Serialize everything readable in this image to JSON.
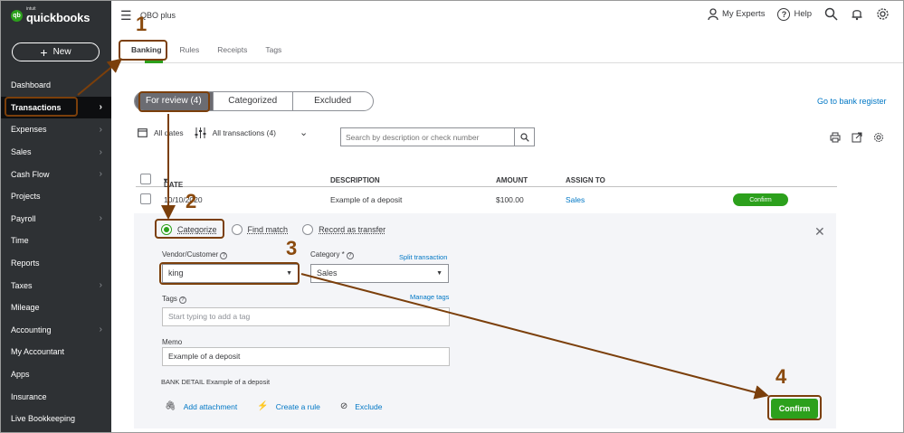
{
  "brand": {
    "logo_small": "intuit",
    "logo_name": "quickbooks",
    "logo_mark": "qb"
  },
  "sidebar": {
    "new_label": "New",
    "items": [
      {
        "label": "Dashboard",
        "chevron": false
      },
      {
        "label": "Transactions",
        "chevron": true,
        "active": true
      },
      {
        "label": "Expenses",
        "chevron": true
      },
      {
        "label": "Sales",
        "chevron": true
      },
      {
        "label": "Cash Flow",
        "chevron": true
      },
      {
        "label": "Projects",
        "chevron": false
      },
      {
        "label": "Payroll",
        "chevron": true
      },
      {
        "label": "Time",
        "chevron": false
      },
      {
        "label": "Reports",
        "chevron": false
      },
      {
        "label": "Taxes",
        "chevron": true
      },
      {
        "label": "Mileage",
        "chevron": false
      },
      {
        "label": "Accounting",
        "chevron": true
      },
      {
        "label": "My Accountant",
        "chevron": false
      },
      {
        "label": "Apps",
        "chevron": false
      },
      {
        "label": "Insurance",
        "chevron": false
      },
      {
        "label": "Live Bookkeeping",
        "chevron": false
      }
    ]
  },
  "header": {
    "company": "QBO plus",
    "my_experts": "My Experts",
    "help": "Help"
  },
  "tabs": [
    {
      "label": "Banking",
      "active": true
    },
    {
      "label": "Rules"
    },
    {
      "label": "Receipts"
    },
    {
      "label": "Tags"
    }
  ],
  "review_tabs": {
    "for_review": "For review (4)",
    "categorized": "Categorized",
    "excluded": "Excluded"
  },
  "go_to_register": "Go to bank register",
  "filters": {
    "dates": "All dates",
    "transactions": "All transactions (4)",
    "search_placeholder": "Search by description or check number"
  },
  "table": {
    "headers": {
      "date": "DATE",
      "description": "DESCRIPTION",
      "amount": "AMOUNT",
      "assign_to": "ASSIGN TO"
    },
    "row": {
      "date": "10/10/2020",
      "description": "Example of a deposit",
      "amount": "$100.00",
      "assign_to": "Sales",
      "action": "Confirm"
    }
  },
  "detail": {
    "radio_categorize": "Categorize",
    "radio_find_match": "Find match",
    "radio_transfer": "Record as transfer",
    "vendor_label": "Vendor/Customer",
    "vendor_value": "king",
    "category_label": "Category *",
    "category_value": "Sales",
    "split_transaction": "Split transaction",
    "tags_label": "Tags",
    "manage_tags": "Manage tags",
    "tags_placeholder": "Start typing to add a tag",
    "memo_label": "Memo",
    "memo_value": "Example of a deposit",
    "bank_detail_label": "BANK DETAIL",
    "bank_detail_value": "Example of a deposit",
    "add_attachment": "Add attachment",
    "create_rule": "Create a rule",
    "exclude": "Exclude",
    "confirm": "Confirm"
  },
  "annotations": {
    "n1": "1",
    "n2": "2",
    "n3": "3",
    "n4": "4"
  },
  "colors": {
    "annotation": "#7b3f0b",
    "accent_green": "#2ca01c",
    "link_blue": "#0077c5",
    "sidebar_bg": "#2e3134"
  }
}
